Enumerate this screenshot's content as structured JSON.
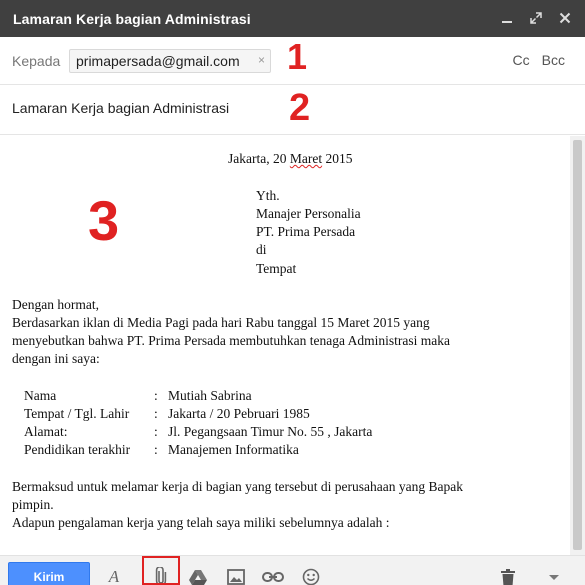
{
  "window": {
    "title": "Lamaran Kerja bagian Administrasi",
    "controls": [
      "minimize-icon",
      "expand-icon",
      "close-icon"
    ]
  },
  "recipients": {
    "to_label": "Kepada",
    "to_chip": "primapersada@gmail.com",
    "chip_remove": "×",
    "cc": "Cc",
    "bcc": "Bcc"
  },
  "subject": "Lamaran Kerja bagian Administrasi",
  "annotations": {
    "one": "1",
    "two": "2",
    "three": "3"
  },
  "letter": {
    "date_place": "Jakarta, 20 ",
    "date_month": "Maret",
    "date_year": " 2015",
    "addr1": "Yth.",
    "addr2": "Manajer Personalia",
    "addr3": "PT. Prima Persada",
    "addr4": "di",
    "addr5": "Tempat",
    "greeting": "Dengan hormat,",
    "p1_l1": "Berdasarkan iklan di Media Pagi  pada hari Rabu tanggal 15 Maret 2015 yang",
    "p1_l2": "menyebutkan bahwa PT. Prima Persada membutuhkan tenaga    Administrasi maka",
    "p1_l3": "dengan ini saya:",
    "fields": [
      {
        "label": "Nama",
        "sep": ":",
        "value": "Mutiah Sabrina"
      },
      {
        "label": "Tempat / Tgl. Lahir",
        "sep": ":",
        "value": "Jakarta / 20 Pebruari 1985"
      },
      {
        "label": "Alamat:",
        "sep": ":",
        "value": "Jl. Pegangsaan Timur No. 55 , Jakarta"
      },
      {
        "label": "Pendidikan terakhir",
        "sep": ":",
        "value": "Manajemen Informatika"
      }
    ],
    "p2_l1": "Bermaksud untuk melamar kerja di bagian yang tersebut di perusahaan yang Bapak",
    "p2_l2": "pimpin.",
    "p3_l1": "Adapun pengalaman kerja yang telah saya miliki sebelumnya adalah :"
  },
  "toolbar": {
    "send_label": "Kirim",
    "format_icon_text": "A",
    "icons": [
      "format-text-icon",
      "attach-file-icon",
      "drive-icon",
      "insert-photo-icon",
      "insert-link-icon",
      "emoji-icon",
      "trash-icon",
      "more-options-icon"
    ]
  },
  "colors": {
    "titlebar": "#404040",
    "send_button": "#4d90fe",
    "annotation_red": "#e02222"
  }
}
